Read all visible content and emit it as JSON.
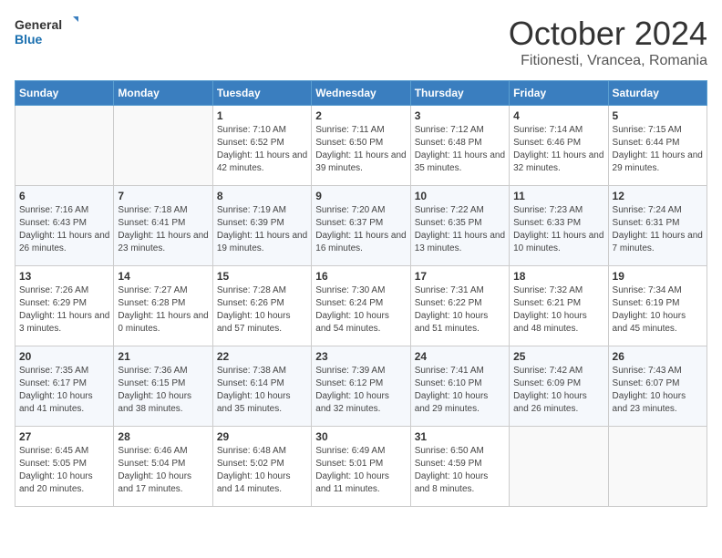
{
  "header": {
    "logo_general": "General",
    "logo_blue": "Blue",
    "month_year": "October 2024",
    "location": "Fitionesti, Vrancea, Romania"
  },
  "weekdays": [
    "Sunday",
    "Monday",
    "Tuesday",
    "Wednesday",
    "Thursday",
    "Friday",
    "Saturday"
  ],
  "weeks": [
    [
      {
        "day": "",
        "sunrise": "",
        "sunset": "",
        "daylight": ""
      },
      {
        "day": "",
        "sunrise": "",
        "sunset": "",
        "daylight": ""
      },
      {
        "day": "1",
        "sunrise": "Sunrise: 7:10 AM",
        "sunset": "Sunset: 6:52 PM",
        "daylight": "Daylight: 11 hours and 42 minutes."
      },
      {
        "day": "2",
        "sunrise": "Sunrise: 7:11 AM",
        "sunset": "Sunset: 6:50 PM",
        "daylight": "Daylight: 11 hours and 39 minutes."
      },
      {
        "day": "3",
        "sunrise": "Sunrise: 7:12 AM",
        "sunset": "Sunset: 6:48 PM",
        "daylight": "Daylight: 11 hours and 35 minutes."
      },
      {
        "day": "4",
        "sunrise": "Sunrise: 7:14 AM",
        "sunset": "Sunset: 6:46 PM",
        "daylight": "Daylight: 11 hours and 32 minutes."
      },
      {
        "day": "5",
        "sunrise": "Sunrise: 7:15 AM",
        "sunset": "Sunset: 6:44 PM",
        "daylight": "Daylight: 11 hours and 29 minutes."
      }
    ],
    [
      {
        "day": "6",
        "sunrise": "Sunrise: 7:16 AM",
        "sunset": "Sunset: 6:43 PM",
        "daylight": "Daylight: 11 hours and 26 minutes."
      },
      {
        "day": "7",
        "sunrise": "Sunrise: 7:18 AM",
        "sunset": "Sunset: 6:41 PM",
        "daylight": "Daylight: 11 hours and 23 minutes."
      },
      {
        "day": "8",
        "sunrise": "Sunrise: 7:19 AM",
        "sunset": "Sunset: 6:39 PM",
        "daylight": "Daylight: 11 hours and 19 minutes."
      },
      {
        "day": "9",
        "sunrise": "Sunrise: 7:20 AM",
        "sunset": "Sunset: 6:37 PM",
        "daylight": "Daylight: 11 hours and 16 minutes."
      },
      {
        "day": "10",
        "sunrise": "Sunrise: 7:22 AM",
        "sunset": "Sunset: 6:35 PM",
        "daylight": "Daylight: 11 hours and 13 minutes."
      },
      {
        "day": "11",
        "sunrise": "Sunrise: 7:23 AM",
        "sunset": "Sunset: 6:33 PM",
        "daylight": "Daylight: 11 hours and 10 minutes."
      },
      {
        "day": "12",
        "sunrise": "Sunrise: 7:24 AM",
        "sunset": "Sunset: 6:31 PM",
        "daylight": "Daylight: 11 hours and 7 minutes."
      }
    ],
    [
      {
        "day": "13",
        "sunrise": "Sunrise: 7:26 AM",
        "sunset": "Sunset: 6:29 PM",
        "daylight": "Daylight: 11 hours and 3 minutes."
      },
      {
        "day": "14",
        "sunrise": "Sunrise: 7:27 AM",
        "sunset": "Sunset: 6:28 PM",
        "daylight": "Daylight: 11 hours and 0 minutes."
      },
      {
        "day": "15",
        "sunrise": "Sunrise: 7:28 AM",
        "sunset": "Sunset: 6:26 PM",
        "daylight": "Daylight: 10 hours and 57 minutes."
      },
      {
        "day": "16",
        "sunrise": "Sunrise: 7:30 AM",
        "sunset": "Sunset: 6:24 PM",
        "daylight": "Daylight: 10 hours and 54 minutes."
      },
      {
        "day": "17",
        "sunrise": "Sunrise: 7:31 AM",
        "sunset": "Sunset: 6:22 PM",
        "daylight": "Daylight: 10 hours and 51 minutes."
      },
      {
        "day": "18",
        "sunrise": "Sunrise: 7:32 AM",
        "sunset": "Sunset: 6:21 PM",
        "daylight": "Daylight: 10 hours and 48 minutes."
      },
      {
        "day": "19",
        "sunrise": "Sunrise: 7:34 AM",
        "sunset": "Sunset: 6:19 PM",
        "daylight": "Daylight: 10 hours and 45 minutes."
      }
    ],
    [
      {
        "day": "20",
        "sunrise": "Sunrise: 7:35 AM",
        "sunset": "Sunset: 6:17 PM",
        "daylight": "Daylight: 10 hours and 41 minutes."
      },
      {
        "day": "21",
        "sunrise": "Sunrise: 7:36 AM",
        "sunset": "Sunset: 6:15 PM",
        "daylight": "Daylight: 10 hours and 38 minutes."
      },
      {
        "day": "22",
        "sunrise": "Sunrise: 7:38 AM",
        "sunset": "Sunset: 6:14 PM",
        "daylight": "Daylight: 10 hours and 35 minutes."
      },
      {
        "day": "23",
        "sunrise": "Sunrise: 7:39 AM",
        "sunset": "Sunset: 6:12 PM",
        "daylight": "Daylight: 10 hours and 32 minutes."
      },
      {
        "day": "24",
        "sunrise": "Sunrise: 7:41 AM",
        "sunset": "Sunset: 6:10 PM",
        "daylight": "Daylight: 10 hours and 29 minutes."
      },
      {
        "day": "25",
        "sunrise": "Sunrise: 7:42 AM",
        "sunset": "Sunset: 6:09 PM",
        "daylight": "Daylight: 10 hours and 26 minutes."
      },
      {
        "day": "26",
        "sunrise": "Sunrise: 7:43 AM",
        "sunset": "Sunset: 6:07 PM",
        "daylight": "Daylight: 10 hours and 23 minutes."
      }
    ],
    [
      {
        "day": "27",
        "sunrise": "Sunrise: 6:45 AM",
        "sunset": "Sunset: 5:05 PM",
        "daylight": "Daylight: 10 hours and 20 minutes."
      },
      {
        "day": "28",
        "sunrise": "Sunrise: 6:46 AM",
        "sunset": "Sunset: 5:04 PM",
        "daylight": "Daylight: 10 hours and 17 minutes."
      },
      {
        "day": "29",
        "sunrise": "Sunrise: 6:48 AM",
        "sunset": "Sunset: 5:02 PM",
        "daylight": "Daylight: 10 hours and 14 minutes."
      },
      {
        "day": "30",
        "sunrise": "Sunrise: 6:49 AM",
        "sunset": "Sunset: 5:01 PM",
        "daylight": "Daylight: 10 hours and 11 minutes."
      },
      {
        "day": "31",
        "sunrise": "Sunrise: 6:50 AM",
        "sunset": "Sunset: 4:59 PM",
        "daylight": "Daylight: 10 hours and 8 minutes."
      },
      {
        "day": "",
        "sunrise": "",
        "sunset": "",
        "daylight": ""
      },
      {
        "day": "",
        "sunrise": "",
        "sunset": "",
        "daylight": ""
      }
    ]
  ]
}
